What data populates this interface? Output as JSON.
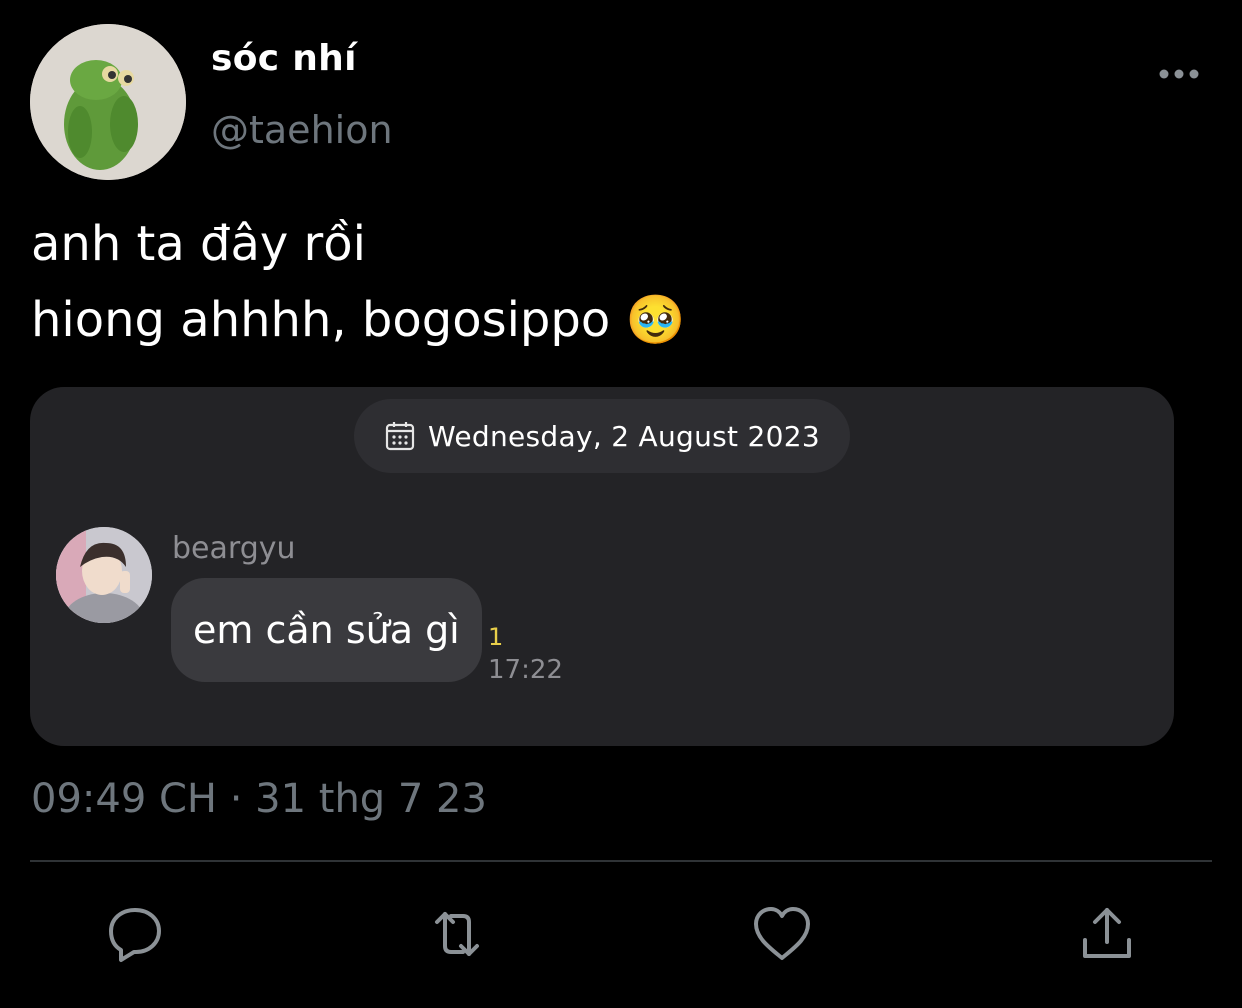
{
  "tweet": {
    "display_name": "sóc nhí",
    "handle": "@taehion",
    "text_line1": "anh ta đây rồi",
    "text_line2": "hiong ahhhh, bogosippo 🥹",
    "timestamp": "09:49 CH · 31 thg 7 23"
  },
  "chat_card": {
    "date": "Wednesday, 2 August 2023",
    "sender": "beargyu",
    "message": "em cần sửa gì",
    "unread_count": "1",
    "time": "17:22"
  },
  "icons": {
    "more": "more-horizontal-icon",
    "reply": "reply-icon",
    "retweet": "retweet-icon",
    "like": "heart-icon",
    "share": "share-icon",
    "calendar": "calendar-icon"
  },
  "colors": {
    "background": "#000000",
    "secondary_text": "#6e767d",
    "card": "#232326",
    "bubble": "#3a3a3e",
    "unread": "#e8cf4a"
  }
}
